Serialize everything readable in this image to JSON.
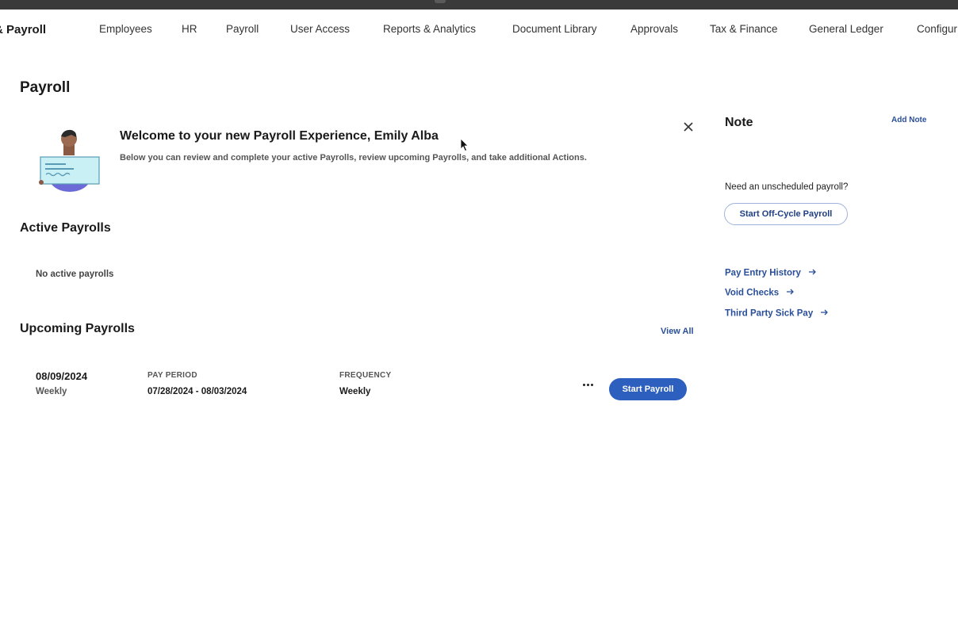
{
  "nav": {
    "brand": "& Payroll",
    "items": [
      "Employees",
      "HR",
      "Payroll",
      "User Access",
      "Reports & Analytics",
      "Document Library",
      "Approvals",
      "Tax & Finance",
      "General Ledger",
      "Configur"
    ]
  },
  "page": {
    "title": "Payroll"
  },
  "welcome": {
    "title": "Welcome to your new Payroll Experience, Emily Alba",
    "subtitle": "Below you can review and complete your active Payrolls, review upcoming Payrolls, and take additional Actions."
  },
  "active_payrolls": {
    "title": "Active Payrolls",
    "empty_text": "No active payrolls"
  },
  "upcoming_payrolls": {
    "title": "Upcoming Payrolls",
    "view_all_label": "View All",
    "rows": [
      {
        "date": "08/09/2024",
        "frequency_short": "Weekly",
        "pay_period_label": "PAY PERIOD",
        "pay_period": "07/28/2024 - 08/03/2024",
        "frequency_label": "FREQUENCY",
        "frequency": "Weekly",
        "more_icon": "ellipsis-icon",
        "start_label": "Start Payroll"
      }
    ]
  },
  "sidebar": {
    "note_title": "Note",
    "add_note_label": "Add Note",
    "unscheduled_text": "Need an unscheduled payroll?",
    "offcycle_label": "Start Off-Cycle Payroll",
    "links": [
      "Pay Entry History",
      "Void Checks",
      "Third Party Sick Pay"
    ]
  },
  "colors": {
    "accent": "#2d5fbf",
    "link": "#2a4f9a",
    "top_strip": "#3a3a3a"
  },
  "icons": {
    "close": "close-icon",
    "arrow": "arrow-right-icon",
    "illustration": "person-holding-check-icon",
    "cursor": "mouse-pointer-icon"
  }
}
